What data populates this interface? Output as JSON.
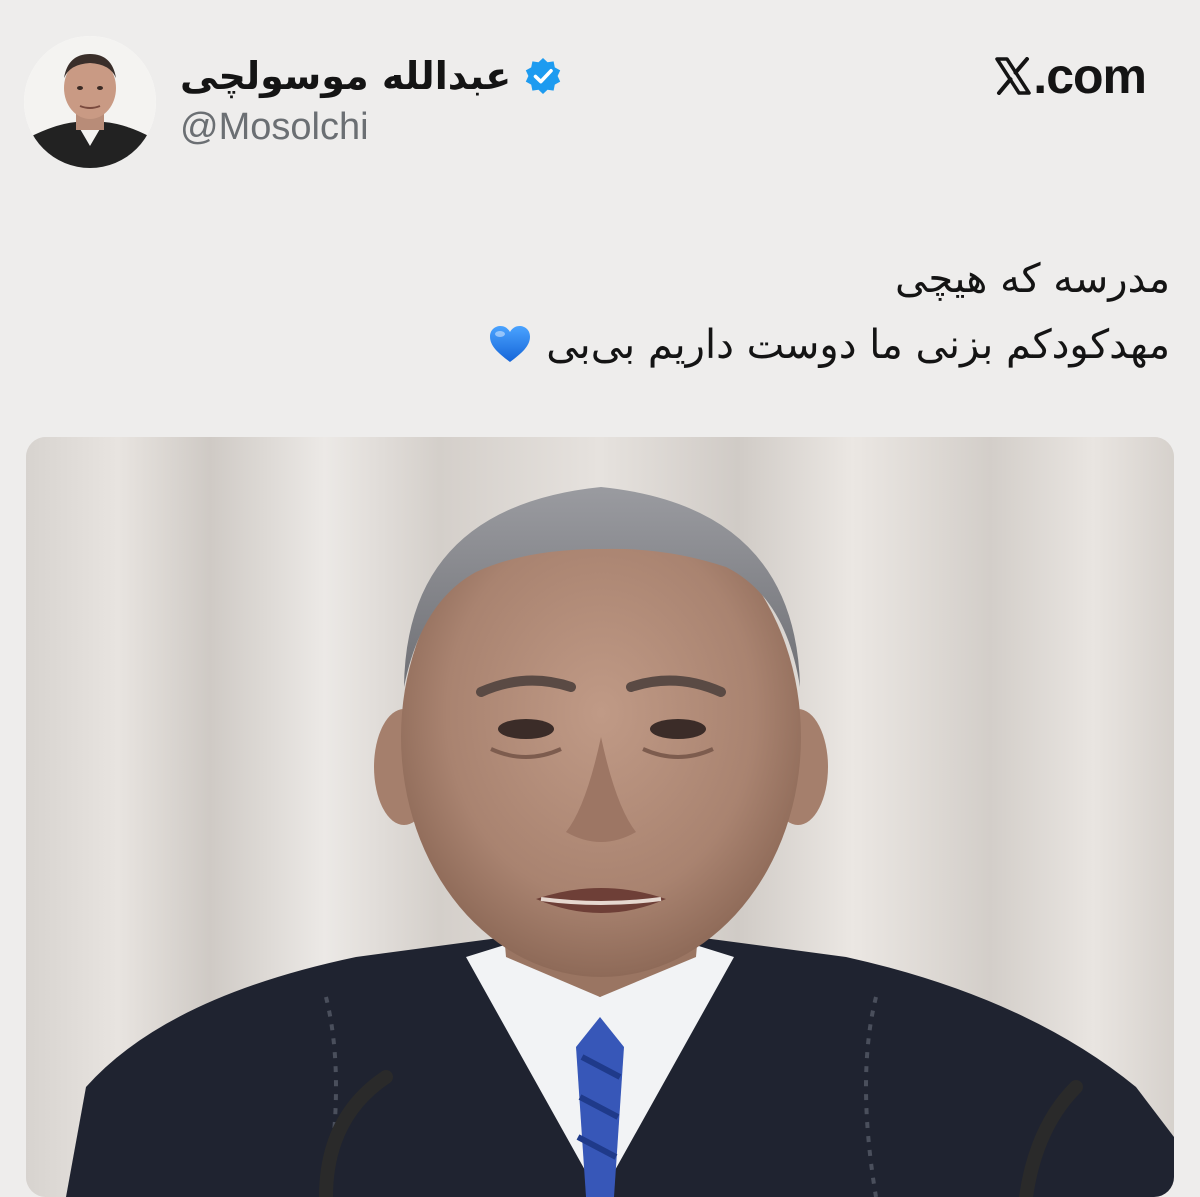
{
  "tweet": {
    "author": {
      "display_name": "عبدالله موسولچی",
      "handle": "@Mosolchi",
      "verified": true,
      "verified_icon": "verified-badge-icon",
      "avatar_icon": "user-avatar"
    },
    "brand": {
      "label": ".com",
      "logo_icon": "x-logo-icon"
    },
    "text_lines": [
      "مدرسه که هیچی",
      "مهدکودکم بزنی ما دوست داریم بی‌بی"
    ],
    "emoji": {
      "icon": "blue-heart-icon",
      "color": "#1e7fe8"
    },
    "media": {
      "type": "photo",
      "icon": "photo-of-man-in-suit"
    }
  },
  "colors": {
    "background": "#eeedec",
    "text": "#141414",
    "handle": "#6b6f73",
    "verified": "#1d9bf0"
  }
}
